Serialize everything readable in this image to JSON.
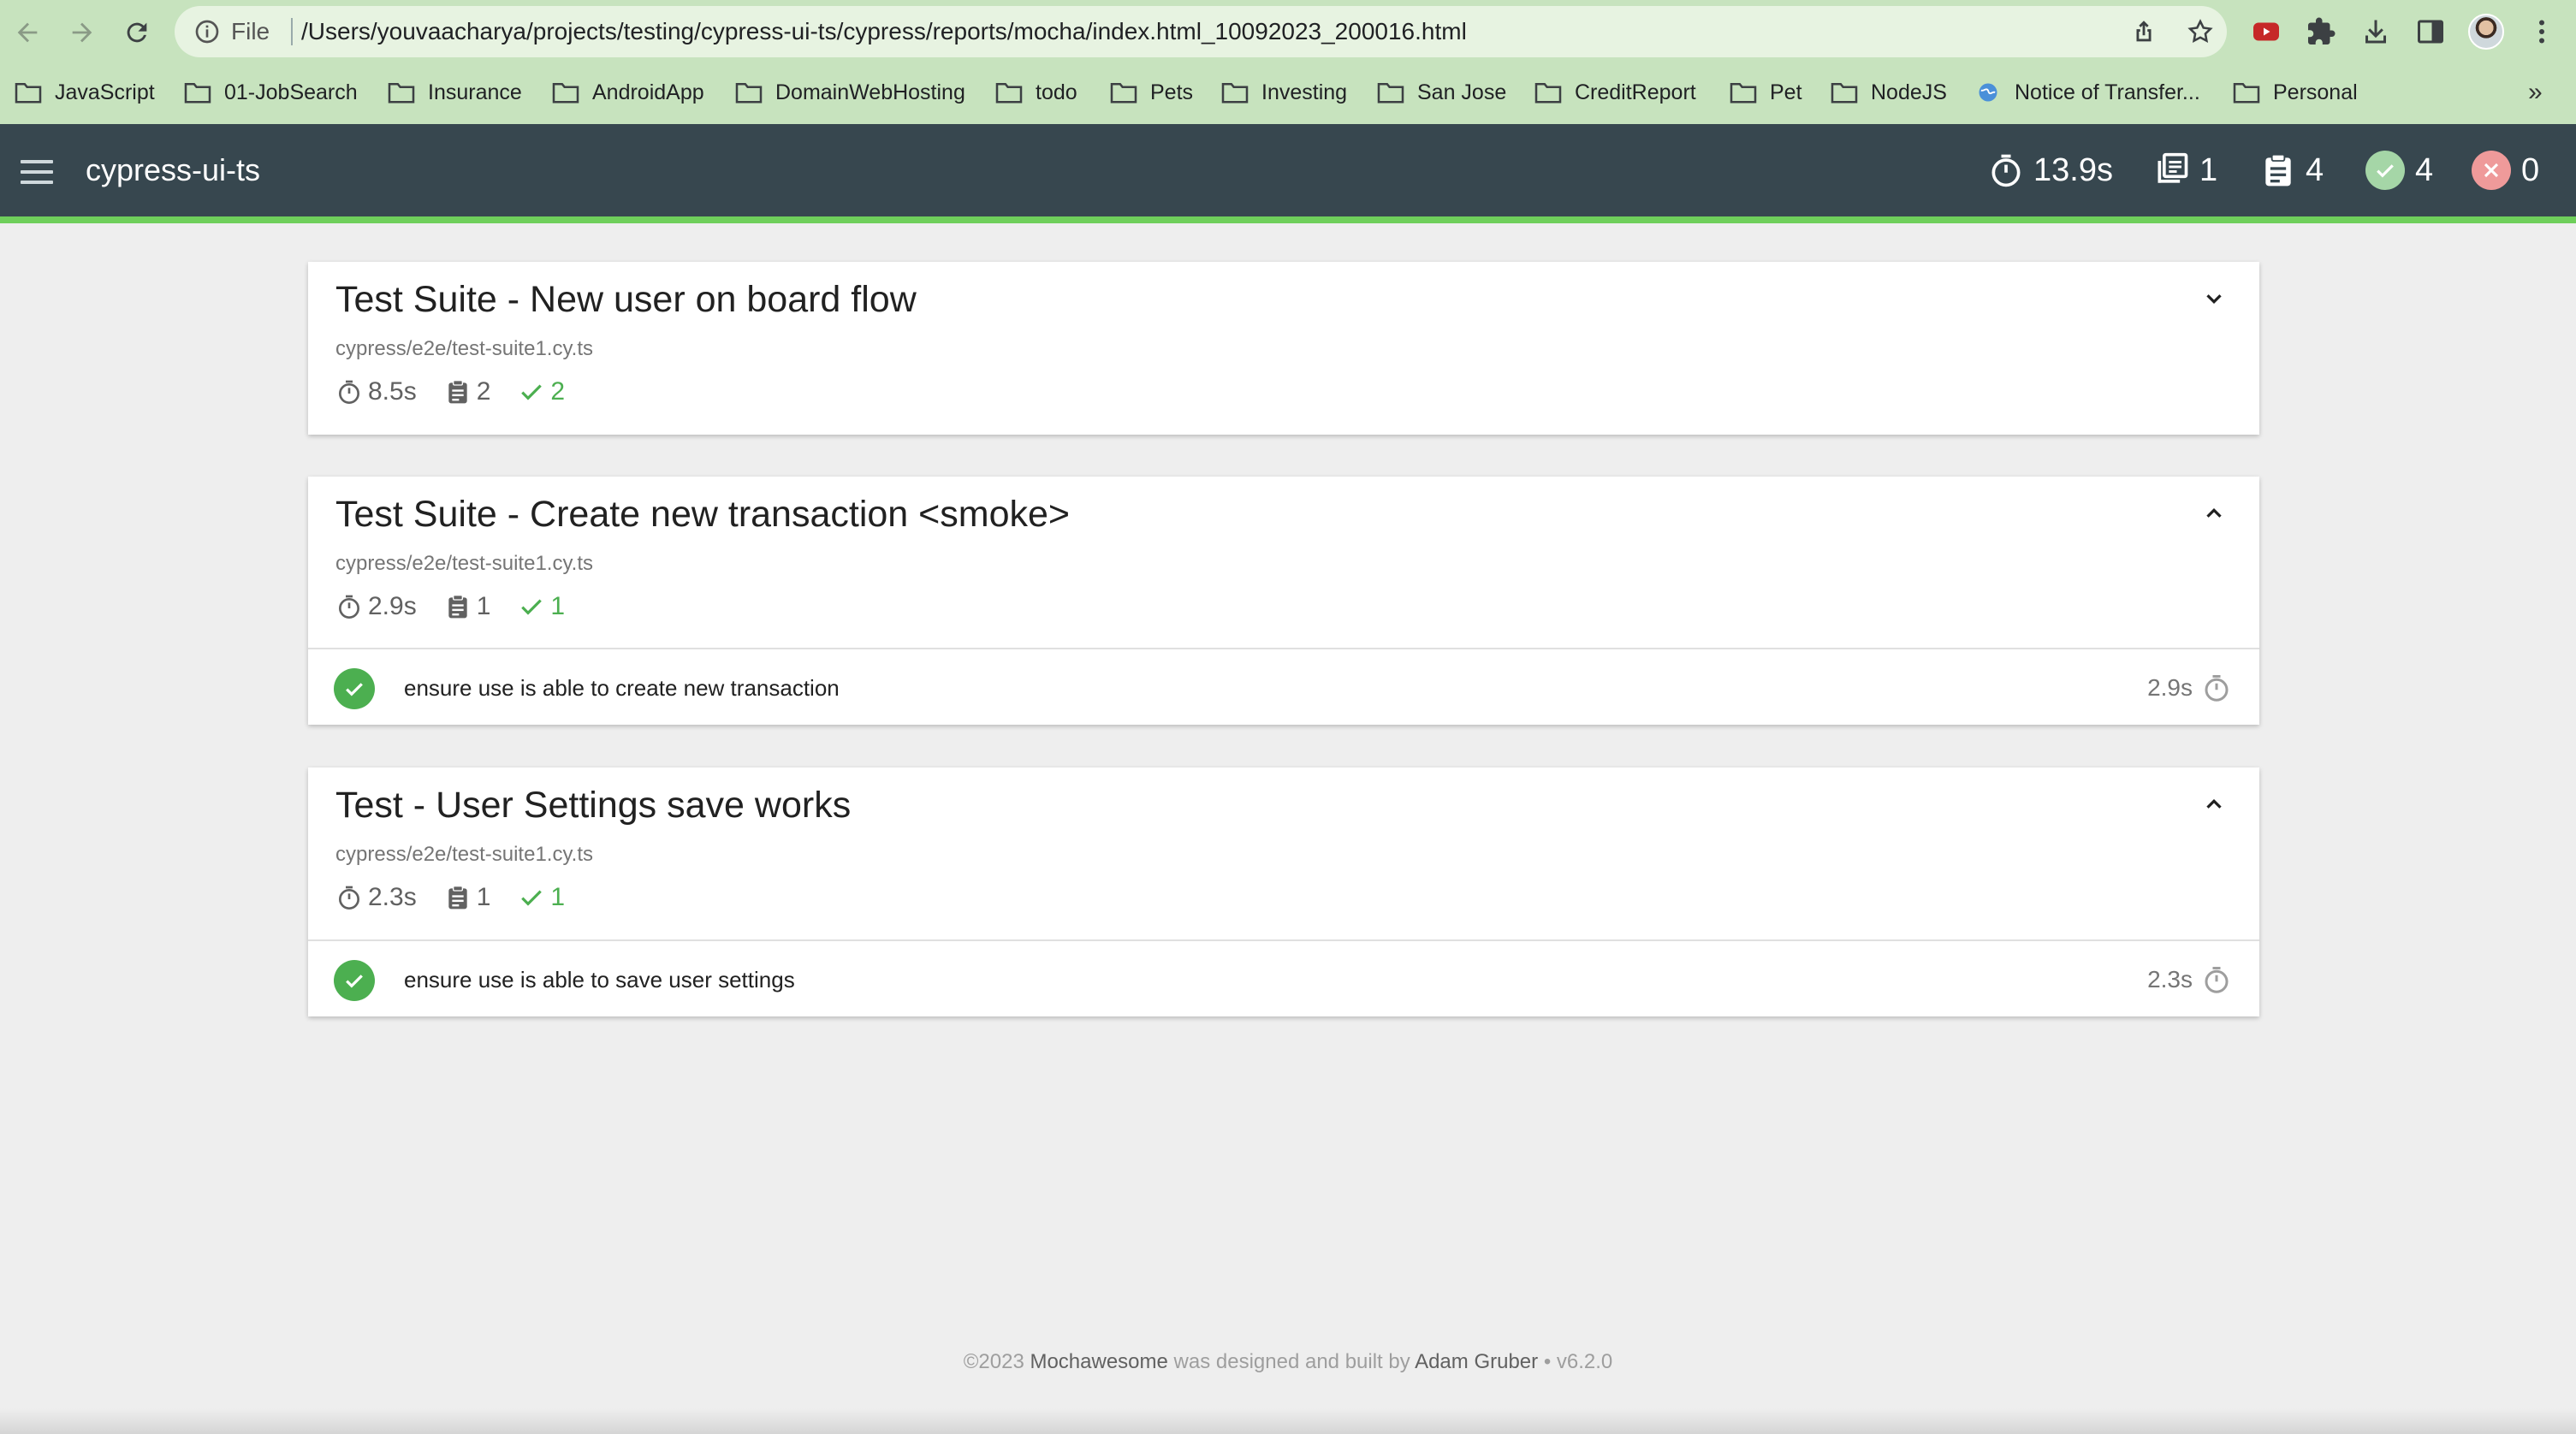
{
  "browser": {
    "scheme": "File",
    "url": "/Users/youvaacharya/projects/testing/cypress-ui-ts/cypress/reports/mocha/index.html_10092023_200016.html",
    "bookmarks": [
      "JavaScript",
      "01-JobSearch",
      "Insurance",
      "AndroidApp",
      "DomainWebHosting",
      "todo",
      "Pets",
      "Investing",
      "San Jose",
      "CreditReport",
      "Pet",
      "NodeJS",
      "Notice of Transfer...",
      "Personal"
    ],
    "more": "»"
  },
  "app": {
    "title": "cypress-ui-ts",
    "stats": {
      "duration": "13.9s",
      "suites": "1",
      "tests": "4",
      "passes": "4",
      "failures": "0"
    }
  },
  "suites": [
    {
      "title": "Test Suite - New user on board flow",
      "file": "cypress/e2e/test-suite1.cy.ts",
      "duration": "8.5s",
      "tests": "2",
      "passes": "2",
      "expanded": false,
      "items": []
    },
    {
      "title": "Test Suite - Create new transaction <smoke>",
      "file": "cypress/e2e/test-suite1.cy.ts",
      "duration": "2.9s",
      "tests": "1",
      "passes": "1",
      "expanded": true,
      "items": [
        {
          "name": "ensure use is able to create new transaction",
          "duration": "2.9s"
        }
      ]
    },
    {
      "title": "Test - User Settings save works",
      "file": "cypress/e2e/test-suite1.cy.ts",
      "duration": "2.3s",
      "tests": "1",
      "passes": "1",
      "expanded": true,
      "items": [
        {
          "name": "ensure use is able to save user settings",
          "duration": "2.3s"
        }
      ]
    }
  ],
  "footer": {
    "copyright": "©2023",
    "brand": "Mochawesome",
    "middle": "was designed and built by",
    "author": "Adam Gruber",
    "version": "• v6.2.0"
  },
  "colors": {
    "header": "#37474f",
    "accent": "#6fcf5b",
    "pass": "#4caf50",
    "fail": "#f44336"
  },
  "icons": [
    "back-icon",
    "forward-icon",
    "reload-icon",
    "info-icon",
    "share-icon",
    "star-icon",
    "youtube-icon",
    "extensions-icon",
    "download-icon",
    "sidepanel-icon",
    "menu-icon",
    "folder-icon",
    "hamburger-icon",
    "stopwatch-icon",
    "suites-icon",
    "clipboard-icon",
    "check-icon",
    "close-icon",
    "chevron-icon"
  ]
}
